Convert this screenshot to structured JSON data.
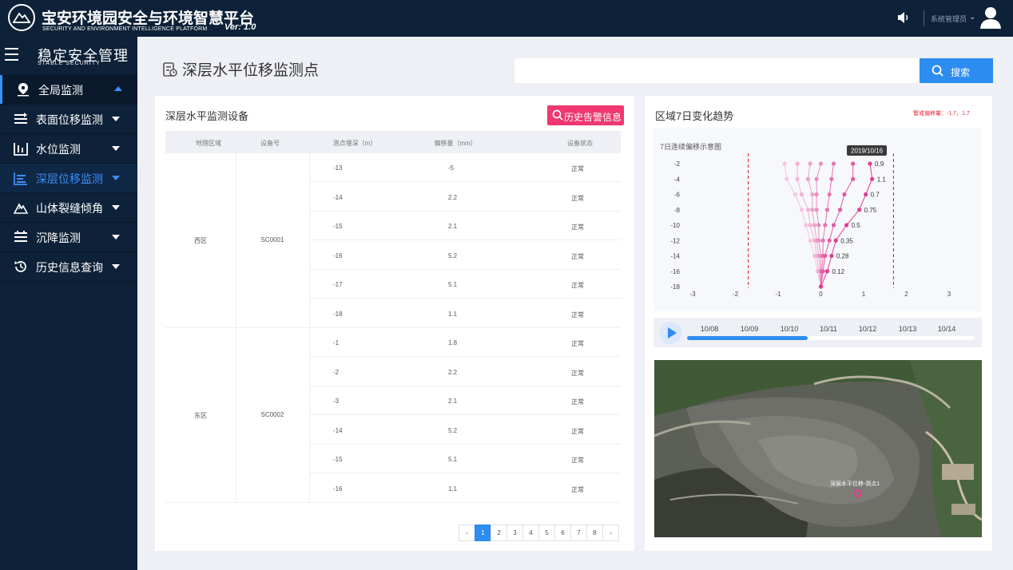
{
  "header": {
    "title": "宝安环境园安全与环境智慧平台",
    "subtitle": "SECURITY AND ENVIRONMENT INTELLIGENCE PLATFORM",
    "version": "Ver: 1.0",
    "user_name": "系统管理员",
    "icons": [
      "logo-icon",
      "volume-icon",
      "chevron-down-icon",
      "user-avatar-icon"
    ]
  },
  "sidebar": {
    "section_title": "稳定安全管理",
    "section_subtitle": "STABLE SECURITY",
    "items": [
      {
        "label": "全局监测",
        "icon": "location-icon",
        "state": "expanded"
      },
      {
        "label": "表面位移监测",
        "icon": "surface-icon"
      },
      {
        "label": "水位监测",
        "icon": "water-level-icon"
      },
      {
        "label": "深层位移监测",
        "icon": "deep-layer-icon",
        "state": "active"
      },
      {
        "label": "山体裂缝倾角",
        "icon": "mountain-icon"
      },
      {
        "label": "沉降监测",
        "icon": "settlement-icon"
      },
      {
        "label": "历史信息查询",
        "icon": "history-icon"
      }
    ]
  },
  "page": {
    "title": "深层水平位移监测点",
    "search_placeholder": "",
    "search_label": "搜索"
  },
  "device_panel": {
    "title": "深层水平监测设备",
    "history_button": "历史告警信息",
    "columns": [
      "地理区域",
      "设备号",
      "测点埋深（m）",
      "偏移量（mm）",
      "设备状态"
    ],
    "regions": [
      {
        "name": "西区",
        "device": "SC0001",
        "rows": [
          {
            "depth": "-13",
            "offset": "-5",
            "status": "正常"
          },
          {
            "depth": "-14",
            "offset": "2.2",
            "status": "正常"
          },
          {
            "depth": "-15",
            "offset": "2.1",
            "status": "正常"
          },
          {
            "depth": "-16",
            "offset": "5.2",
            "status": "正常"
          },
          {
            "depth": "-17",
            "offset": "5.1",
            "status": "正常"
          },
          {
            "depth": "-18",
            "offset": "1.1",
            "status": "正常"
          }
        ]
      },
      {
        "name": "东区",
        "device": "SC0002",
        "rows": [
          {
            "depth": "-1",
            "offset": "1.8",
            "status": "正常"
          },
          {
            "depth": "-2",
            "offset": "2.2",
            "status": "正常"
          },
          {
            "depth": "-3",
            "offset": "2.1",
            "status": "正常"
          },
          {
            "depth": "-14",
            "offset": "5.2",
            "status": "正常"
          },
          {
            "depth": "-15",
            "offset": "5.1",
            "status": "正常"
          },
          {
            "depth": "-16",
            "offset": "1.1",
            "status": "正常"
          }
        ]
      }
    ],
    "pagination": {
      "prev": "«",
      "pages": [
        "1",
        "2",
        "3",
        "4",
        "5",
        "6",
        "7",
        "8"
      ],
      "current": "1",
      "next": "»"
    }
  },
  "trend_panel": {
    "title": "区域7日变化趋势",
    "alarm_threshold": "警戒偏移量：-1.7，1.7",
    "timeline": {
      "dates": [
        "10/08",
        "10/09",
        "10/10",
        "10/11",
        "10/12",
        "10/13",
        "10/14"
      ],
      "progress": 0.42
    },
    "map_label": "深层水平位移-测点1"
  },
  "chart_data": {
    "type": "line",
    "title": "7日连续偏移示意图",
    "tooltip": "2019/10/16",
    "xlim": [
      -3,
      3
    ],
    "ylim": [
      -18,
      -2
    ],
    "x_ticks": [
      -3,
      -2,
      -1,
      0,
      1,
      2,
      3
    ],
    "y_ticks": [
      -2,
      -4,
      -6,
      -8,
      -10,
      -12,
      -14,
      -16,
      -18
    ],
    "alarm_lines": [
      -1.7,
      1.7
    ],
    "depths": [
      -2,
      -4,
      -6,
      -8,
      -10,
      -12,
      -14,
      -16,
      -18
    ],
    "series": [
      {
        "values": [
          -0.85,
          -0.8,
          -0.6,
          -0.45,
          -0.35,
          -0.25,
          -0.15,
          -0.08,
          0
        ],
        "color": "#f4c6df"
      },
      {
        "values": [
          -0.55,
          -0.55,
          -0.45,
          -0.3,
          -0.25,
          -0.15,
          -0.1,
          -0.05,
          0
        ],
        "color": "#f2b3d4"
      },
      {
        "values": [
          -0.25,
          -0.3,
          -0.2,
          -0.2,
          -0.15,
          -0.1,
          -0.05,
          -0.02,
          0
        ],
        "color": "#eea0c9"
      },
      {
        "values": [
          0,
          -0.1,
          -0.1,
          -0.1,
          -0.05,
          -0.05,
          0,
          0,
          0
        ],
        "color": "#ea8cbe"
      },
      {
        "values": [
          0.3,
          0.25,
          0.2,
          0.15,
          0.1,
          0.05,
          0.05,
          0.02,
          0
        ],
        "color": "#e673b1"
      },
      {
        "values": [
          0.75,
          0.75,
          0.55,
          0.45,
          0.3,
          0.2,
          0.1,
          0.05,
          0
        ],
        "color": "#e35aa4"
      },
      {
        "values": [
          1.15,
          1.2,
          1.05,
          0.9,
          0.6,
          0.35,
          0.25,
          0.15,
          0
        ],
        "color": "#e03d94"
      }
    ],
    "labels": [
      {
        "depth": -2,
        "text": "0.9"
      },
      {
        "depth": -4,
        "text": "1.1"
      },
      {
        "depth": -6,
        "text": "0.7"
      },
      {
        "depth": -8,
        "text": "0.75"
      },
      {
        "depth": -10,
        "text": "0.5"
      },
      {
        "depth": -12,
        "text": "0.35"
      },
      {
        "depth": -14,
        "text": "0.28"
      },
      {
        "depth": -16,
        "text": "0.12"
      }
    ]
  }
}
